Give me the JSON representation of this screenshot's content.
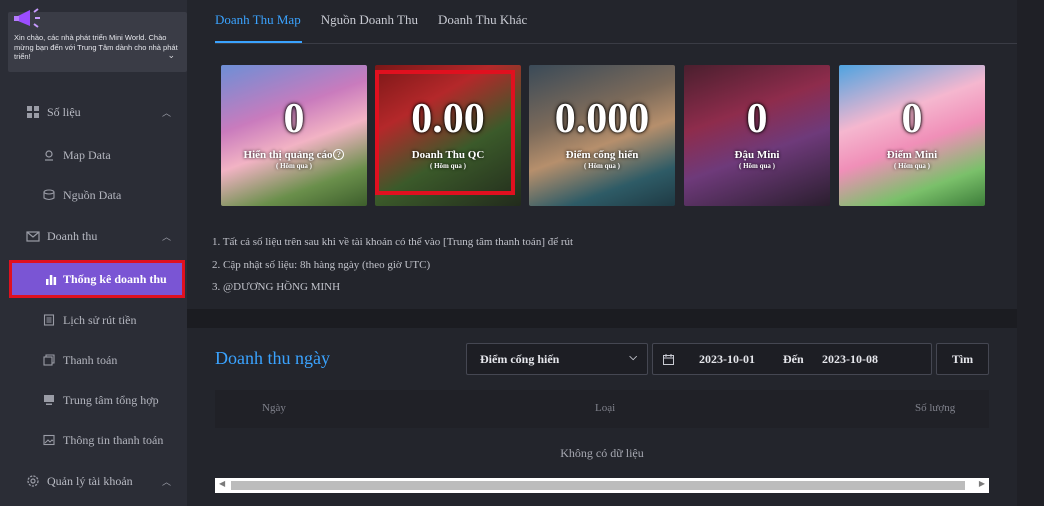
{
  "sidebar": {
    "welcome_text": "Xin chào, các nhà phát triển Mini World. Chào mừng bạn đến với Trung Tâm dành cho nhà phát triển!",
    "sections": [
      {
        "label": "Số liệu",
        "icon": "grid-icon"
      },
      {
        "label": "Doanh thu",
        "icon": "mail-icon"
      },
      {
        "label": "Quản lý tài khoản",
        "icon": "gear-icon"
      }
    ],
    "items": [
      {
        "label": "Map Data",
        "icon": "location-icon"
      },
      {
        "label": "Nguồn Data",
        "icon": "database-icon"
      },
      {
        "label": "Thống kê doanh thu",
        "icon": "bar-chart-icon"
      },
      {
        "label": "Lịch sử rút tiền",
        "icon": "document-icon"
      },
      {
        "label": "Thanh toán",
        "icon": "copy-icon"
      },
      {
        "label": "Trung tâm tổng hợp",
        "icon": "monitor-icon"
      },
      {
        "label": "Thông tin thanh toán",
        "icon": "image-icon"
      }
    ],
    "active_item": "Thống kê doanh thu"
  },
  "tabs": [
    "Doanh Thu Map",
    "Nguồn Doanh Thu",
    "Doanh Thu Khác"
  ],
  "cards": [
    {
      "value": "0",
      "label": "Hiển thị quảng cáo",
      "sub": "( Hôm qua )"
    },
    {
      "value": "0.00",
      "label": "Doanh Thu QC",
      "sub": "( Hôm qua )"
    },
    {
      "value": "0.000",
      "label": "Điểm cống hiến",
      "sub": "( Hôm qua )"
    },
    {
      "value": "0",
      "label": "Đậu Mini",
      "sub": "( Hôm qua )"
    },
    {
      "value": "0",
      "label": "Điểm Mini",
      "sub": "( Hôm qua )"
    }
  ],
  "notes": [
    "1. Tất cả số liệu trên sau khi về tài khoản có thể vào [Trung tâm thanh toán] để rút",
    "2. Cập nhật số liệu: 8h hàng ngày (theo giờ UTC)",
    "3. @DƯƠNG HỒNG MINH"
  ],
  "daily": {
    "title": "Doanh thu ngày",
    "select_value": "Điểm cống hiến",
    "date_from": "2023-10-01",
    "date_sep": "Đến",
    "date_to": "2023-10-08",
    "search_label": "Tìm",
    "columns": [
      "Ngày",
      "Loại",
      "Số lượng"
    ],
    "empty_text": "Không có dữ liệu"
  },
  "colors": {
    "accent": "#3aa3ff",
    "active_item": "#7a55d4",
    "highlight": "#e0101f"
  }
}
